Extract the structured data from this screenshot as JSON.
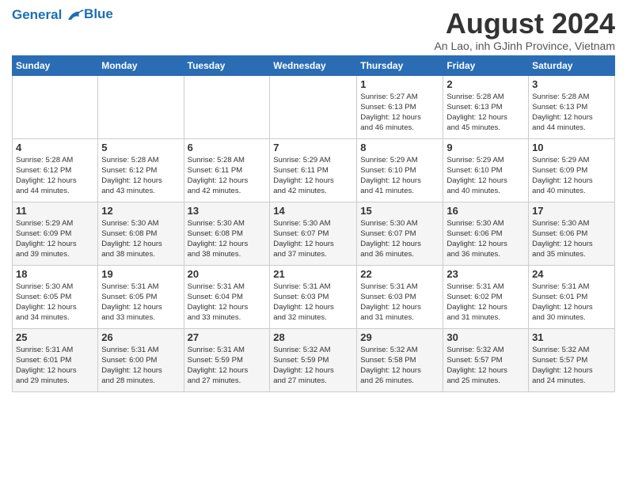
{
  "header": {
    "logo_line1": "General",
    "logo_line2": "Blue",
    "month_title": "August 2024",
    "subtitle": "An Lao, inh GJinh Province, Vietnam"
  },
  "weekdays": [
    "Sunday",
    "Monday",
    "Tuesday",
    "Wednesday",
    "Thursday",
    "Friday",
    "Saturday"
  ],
  "weeks": [
    [
      {
        "day": "",
        "info": ""
      },
      {
        "day": "",
        "info": ""
      },
      {
        "day": "",
        "info": ""
      },
      {
        "day": "",
        "info": ""
      },
      {
        "day": "1",
        "info": "Sunrise: 5:27 AM\nSunset: 6:13 PM\nDaylight: 12 hours\nand 46 minutes."
      },
      {
        "day": "2",
        "info": "Sunrise: 5:28 AM\nSunset: 6:13 PM\nDaylight: 12 hours\nand 45 minutes."
      },
      {
        "day": "3",
        "info": "Sunrise: 5:28 AM\nSunset: 6:13 PM\nDaylight: 12 hours\nand 44 minutes."
      }
    ],
    [
      {
        "day": "4",
        "info": "Sunrise: 5:28 AM\nSunset: 6:12 PM\nDaylight: 12 hours\nand 44 minutes."
      },
      {
        "day": "5",
        "info": "Sunrise: 5:28 AM\nSunset: 6:12 PM\nDaylight: 12 hours\nand 43 minutes."
      },
      {
        "day": "6",
        "info": "Sunrise: 5:28 AM\nSunset: 6:11 PM\nDaylight: 12 hours\nand 42 minutes."
      },
      {
        "day": "7",
        "info": "Sunrise: 5:29 AM\nSunset: 6:11 PM\nDaylight: 12 hours\nand 42 minutes."
      },
      {
        "day": "8",
        "info": "Sunrise: 5:29 AM\nSunset: 6:10 PM\nDaylight: 12 hours\nand 41 minutes."
      },
      {
        "day": "9",
        "info": "Sunrise: 5:29 AM\nSunset: 6:10 PM\nDaylight: 12 hours\nand 40 minutes."
      },
      {
        "day": "10",
        "info": "Sunrise: 5:29 AM\nSunset: 6:09 PM\nDaylight: 12 hours\nand 40 minutes."
      }
    ],
    [
      {
        "day": "11",
        "info": "Sunrise: 5:29 AM\nSunset: 6:09 PM\nDaylight: 12 hours\nand 39 minutes."
      },
      {
        "day": "12",
        "info": "Sunrise: 5:30 AM\nSunset: 6:08 PM\nDaylight: 12 hours\nand 38 minutes."
      },
      {
        "day": "13",
        "info": "Sunrise: 5:30 AM\nSunset: 6:08 PM\nDaylight: 12 hours\nand 38 minutes."
      },
      {
        "day": "14",
        "info": "Sunrise: 5:30 AM\nSunset: 6:07 PM\nDaylight: 12 hours\nand 37 minutes."
      },
      {
        "day": "15",
        "info": "Sunrise: 5:30 AM\nSunset: 6:07 PM\nDaylight: 12 hours\nand 36 minutes."
      },
      {
        "day": "16",
        "info": "Sunrise: 5:30 AM\nSunset: 6:06 PM\nDaylight: 12 hours\nand 36 minutes."
      },
      {
        "day": "17",
        "info": "Sunrise: 5:30 AM\nSunset: 6:06 PM\nDaylight: 12 hours\nand 35 minutes."
      }
    ],
    [
      {
        "day": "18",
        "info": "Sunrise: 5:30 AM\nSunset: 6:05 PM\nDaylight: 12 hours\nand 34 minutes."
      },
      {
        "day": "19",
        "info": "Sunrise: 5:31 AM\nSunset: 6:05 PM\nDaylight: 12 hours\nand 33 minutes."
      },
      {
        "day": "20",
        "info": "Sunrise: 5:31 AM\nSunset: 6:04 PM\nDaylight: 12 hours\nand 33 minutes."
      },
      {
        "day": "21",
        "info": "Sunrise: 5:31 AM\nSunset: 6:03 PM\nDaylight: 12 hours\nand 32 minutes."
      },
      {
        "day": "22",
        "info": "Sunrise: 5:31 AM\nSunset: 6:03 PM\nDaylight: 12 hours\nand 31 minutes."
      },
      {
        "day": "23",
        "info": "Sunrise: 5:31 AM\nSunset: 6:02 PM\nDaylight: 12 hours\nand 31 minutes."
      },
      {
        "day": "24",
        "info": "Sunrise: 5:31 AM\nSunset: 6:01 PM\nDaylight: 12 hours\nand 30 minutes."
      }
    ],
    [
      {
        "day": "25",
        "info": "Sunrise: 5:31 AM\nSunset: 6:01 PM\nDaylight: 12 hours\nand 29 minutes."
      },
      {
        "day": "26",
        "info": "Sunrise: 5:31 AM\nSunset: 6:00 PM\nDaylight: 12 hours\nand 28 minutes."
      },
      {
        "day": "27",
        "info": "Sunrise: 5:31 AM\nSunset: 5:59 PM\nDaylight: 12 hours\nand 27 minutes."
      },
      {
        "day": "28",
        "info": "Sunrise: 5:32 AM\nSunset: 5:59 PM\nDaylight: 12 hours\nand 27 minutes."
      },
      {
        "day": "29",
        "info": "Sunrise: 5:32 AM\nSunset: 5:58 PM\nDaylight: 12 hours\nand 26 minutes."
      },
      {
        "day": "30",
        "info": "Sunrise: 5:32 AM\nSunset: 5:57 PM\nDaylight: 12 hours\nand 25 minutes."
      },
      {
        "day": "31",
        "info": "Sunrise: 5:32 AM\nSunset: 5:57 PM\nDaylight: 12 hours\nand 24 minutes."
      }
    ]
  ]
}
